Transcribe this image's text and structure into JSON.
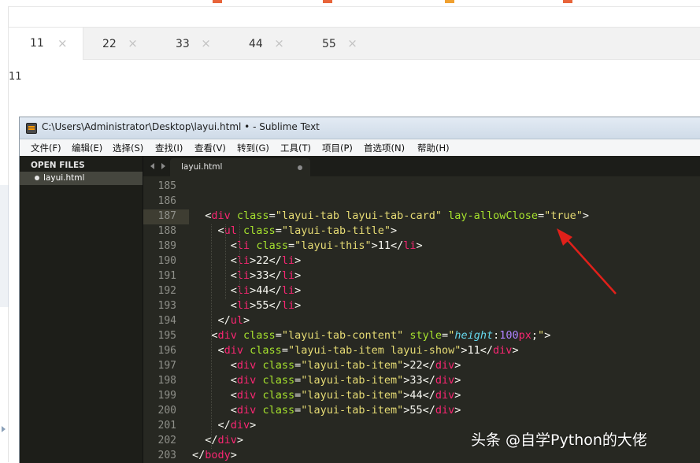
{
  "browser": {
    "tabs": [
      {
        "label": "11",
        "active": true
      },
      {
        "label": "22",
        "active": false
      },
      {
        "label": "33",
        "active": false
      },
      {
        "label": "44",
        "active": false
      },
      {
        "label": "55",
        "active": false
      }
    ],
    "close_glyph": "×",
    "tab_content": "11"
  },
  "editor": {
    "title": "C:\\Users\\Administrator\\Desktop\\layui.html • - Sublime Text",
    "menu": [
      "文件(F)",
      "编辑(E)",
      "选择(S)",
      "查找(I)",
      "查看(V)",
      "转到(G)",
      "工具(T)",
      "项目(P)",
      "首选项(N)",
      "帮助(H)"
    ],
    "sidebar": {
      "header": "OPEN FILES",
      "files": [
        "layui.html"
      ]
    },
    "file_tab": "layui.html",
    "current_line": 187,
    "lines": [
      {
        "n": "185",
        "code": ""
      },
      {
        "n": "186",
        "code": ""
      },
      {
        "n": "187",
        "code": "  <div class=\"layui-tab layui-tab-card\" lay-allowClose=\"true\">"
      },
      {
        "n": "188",
        "code": "    <ul class=\"layui-tab-title\">"
      },
      {
        "n": "189",
        "code": "      <li class=\"layui-this\">11</li>"
      },
      {
        "n": "190",
        "code": "      <li>22</li>"
      },
      {
        "n": "191",
        "code": "      <li>33</li>"
      },
      {
        "n": "192",
        "code": "      <li>44</li>"
      },
      {
        "n": "193",
        "code": "      <li>55</li>"
      },
      {
        "n": "194",
        "code": "    </ul>"
      },
      {
        "n": "195",
        "code": "   <div class=\"layui-tab-content\" style=\"height:100px;\">"
      },
      {
        "n": "196",
        "code": "    <div class=\"layui-tab-item layui-show\">11</div>"
      },
      {
        "n": "197",
        "code": "      <div class=\"layui-tab-item\">22</div>"
      },
      {
        "n": "198",
        "code": "      <div class=\"layui-tab-item\">33</div>"
      },
      {
        "n": "199",
        "code": "      <div class=\"layui-tab-item\">44</div>"
      },
      {
        "n": "200",
        "code": "      <div class=\"layui-tab-item\">55</div>"
      },
      {
        "n": "201",
        "code": "    </div>"
      },
      {
        "n": "202",
        "code": "  </div>"
      },
      {
        "n": "203",
        "code": "</body>"
      }
    ]
  },
  "watermark": "头条 @自学Python的大佬",
  "colors": {
    "editor_bg": "#272822",
    "tag": "#f92672",
    "attribute": "#a6e22e",
    "string": "#e6db74",
    "css_property": "#66d9ef",
    "number": "#ae81ff",
    "annotation_arrow": "#e0201a"
  },
  "icons": [
    "close-icon",
    "sublime-app-icon",
    "nav-left-icon",
    "nav-right-icon",
    "unsaved-dot-icon",
    "red-arrow-annotation"
  ]
}
